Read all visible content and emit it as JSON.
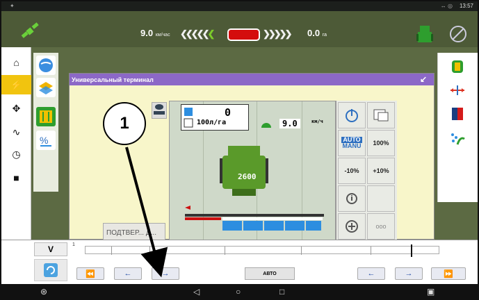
{
  "status_bar": {
    "time": "13:57",
    "signal": "↔ ◎"
  },
  "top_bar": {
    "speed_value": "9.0",
    "speed_unit": "км/час",
    "left_chevrons": "❮❮❮❮❮",
    "left_active_chevron": "❮",
    "right_chevrons": "❯❯❯❯❯",
    "area_value": "0.0",
    "area_unit": "га"
  },
  "left_nav": {
    "items": [
      {
        "icon": "home-icon",
        "glyph": "⌂"
      },
      {
        "icon": "run-icon",
        "glyph": "⚡"
      },
      {
        "icon": "satellite-icon",
        "glyph": "✥"
      },
      {
        "icon": "pulse-icon",
        "glyph": "∿"
      },
      {
        "icon": "speedometer-icon",
        "glyph": "◷"
      },
      {
        "icon": "camera-icon",
        "glyph": "■"
      }
    ]
  },
  "terminal": {
    "title": "Универсальный терминал",
    "minimize": "↙",
    "value_main": "0",
    "rate": "100л/га",
    "speed_display": "9.0",
    "speed_unit": "км/ч",
    "tank": "2600",
    "confirm": "ПОДТВЕР... Д...",
    "softkeys": {
      "auto": "AUTO",
      "manu": "MANU",
      "p100": "100%",
      "minus10": "-10%",
      "plus10": "+10%",
      "info": "i",
      "dots": "ooo"
    }
  },
  "bottom_bar": {
    "v_label": "V",
    "track_start": "1",
    "auto_label": "АВТО",
    "nav_buttons": [
      "⏪",
      "←",
      "→",
      "←",
      "→",
      "⏩"
    ]
  },
  "callout": {
    "label": "1"
  },
  "colors": {
    "top_bar": "#4d5a37",
    "terminal_header": "#8c68c7",
    "terminal_bg": "#f8f6ca",
    "active_nav": "#f1c40f",
    "red_status": "#d40d0d",
    "green_chevron": "#7dcc2a"
  }
}
